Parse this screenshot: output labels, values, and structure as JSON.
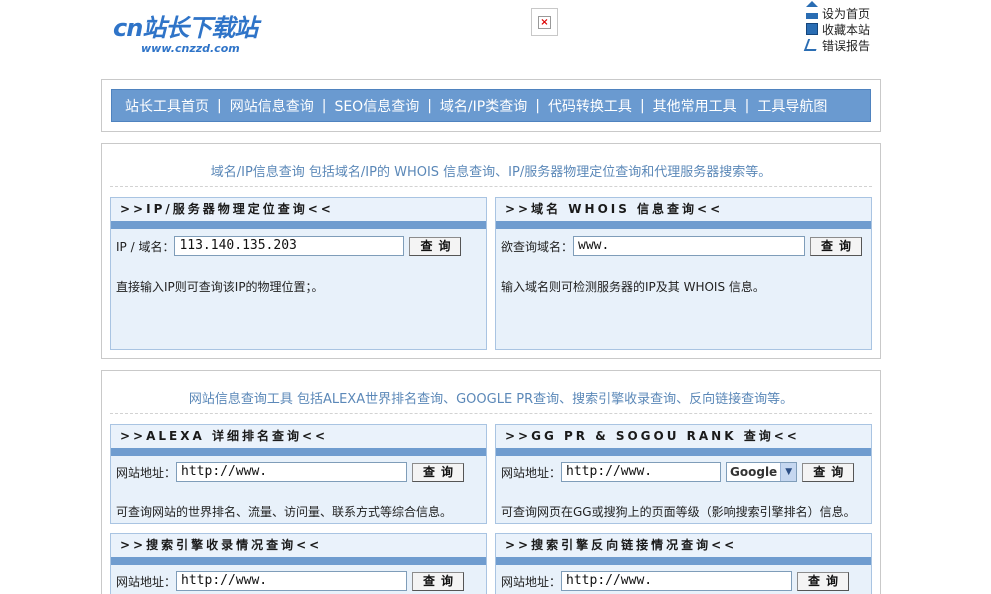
{
  "header": {
    "logo_text": "cn站长下载站",
    "logo_url": "www.cnzzd.com",
    "toplinks": [
      {
        "label": "设为首页",
        "icon": "home-icon"
      },
      {
        "label": "收藏本站",
        "icon": "bookmark-icon"
      },
      {
        "label": "错误报告",
        "icon": "edit-icon"
      }
    ]
  },
  "nav": {
    "items": [
      "站长工具首页",
      "网站信息查询",
      "SEO信息查询",
      "域名/IP类查询",
      "代码转换工具",
      "其他常用工具",
      "工具导航图"
    ],
    "separator": "|"
  },
  "section1": {
    "title": "域名/IP信息查询 包括域名/IP的 WHOIS 信息查询、IP/服务器物理定位查询和代理服务器搜索等。",
    "panels": [
      {
        "heading": ">>IP/服务器物理定位查询<<",
        "label": "IP / 域名：",
        "value": "113.140.135.203",
        "button": "查询",
        "desc": "直接输入IP则可查询该IP的物理位置；。"
      },
      {
        "heading": ">>域名 WHOIS 信息查询<<",
        "label": "欲查询域名：",
        "value": "www.",
        "button": "查询",
        "desc": "输入域名则可检测服务器的IP及其 WHOIS 信息。"
      }
    ]
  },
  "section2": {
    "title": "网站信息查询工具 包括ALEXA世界排名查询、GOOGLE PR查询、搜索引擎收录查询、反向链接查询等。",
    "panels": [
      {
        "heading": ">>ALEXA 详细排名查询<<",
        "label": "网站地址：",
        "value": "http://www.",
        "button": "查询",
        "desc": "可查询网站的世界排名、流量、访问量、联系方式等综合信息。"
      },
      {
        "heading": ">>GG PR & SOGOU RANK 查询<<",
        "label": "网站地址：",
        "value": "http://www.",
        "select": "Google",
        "button": "查询",
        "desc": "可查询网页在GG或搜狗上的页面等级（影响搜索引擎排名）信息。"
      },
      {
        "heading": ">>搜索引擎收录情况查询<<",
        "label": "网站地址：",
        "value": "http://www.",
        "button": "查询"
      },
      {
        "heading": ">>搜索引擎反向链接情况查询<<",
        "label": "网站地址：",
        "value": "http://www.",
        "button": "查询"
      }
    ]
  }
}
